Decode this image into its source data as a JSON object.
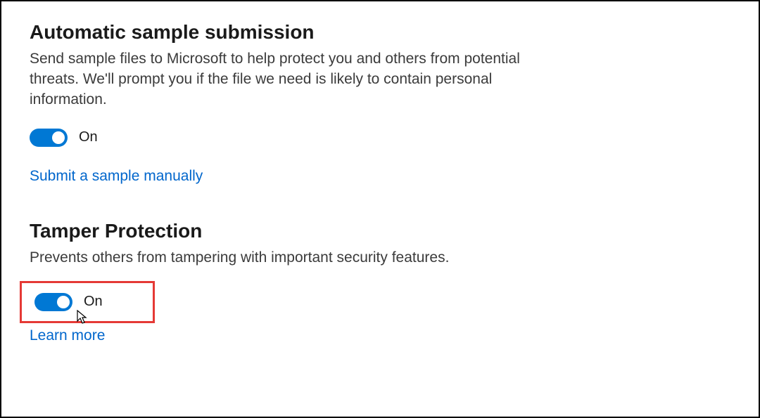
{
  "sections": {
    "autoSample": {
      "title": "Automatic sample submission",
      "description": "Send sample files to Microsoft to help protect you and others from potential threats. We'll prompt you if the file we need is likely to contain personal information.",
      "toggleState": "On",
      "link": "Submit a sample manually"
    },
    "tamperProtection": {
      "title": "Tamper Protection",
      "description": "Prevents others from tampering with important security features.",
      "toggleState": "On",
      "link": "Learn more"
    }
  },
  "colors": {
    "toggleOn": "#0078d4",
    "link": "#0066cc",
    "highlight": "#e53935"
  }
}
